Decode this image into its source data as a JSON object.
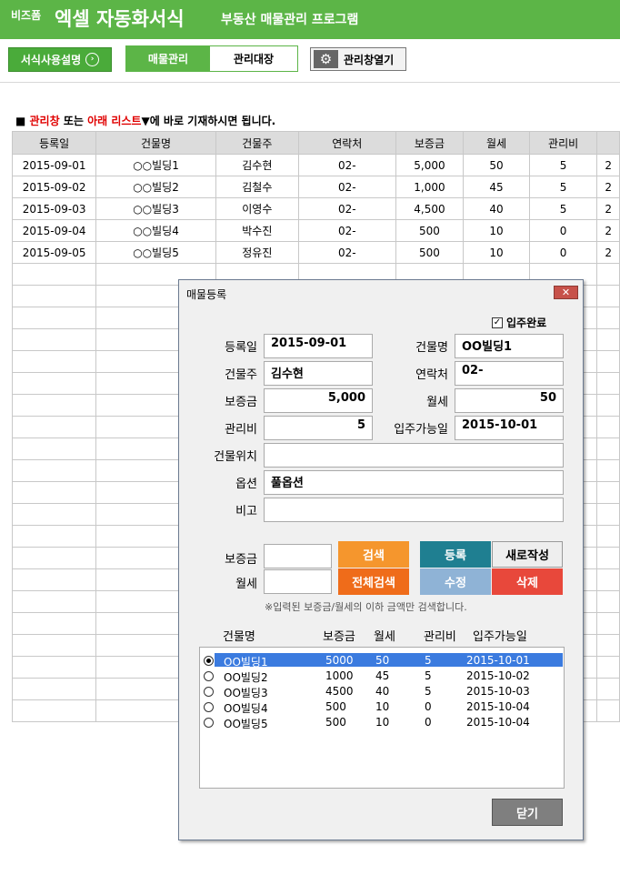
{
  "header": {
    "brand_small": "비즈폼",
    "brand_big": "엑셀 자동화서식",
    "subtitle": "부동산 매물관리 프로그램"
  },
  "toolbar": {
    "guide_label": "서식사용설명",
    "tabs": [
      "매물관리",
      "관리대장"
    ],
    "open_label": "관리창열기"
  },
  "note": {
    "prefix": "■ ",
    "red1": "관리창",
    "mid": " 또는 ",
    "red2": "아래 리스트",
    "suffix": "▼에 바로 기재하시면 됩니다."
  },
  "sheet": {
    "headers": [
      "등록일",
      "건물명",
      "건물주",
      "연락처",
      "보증금",
      "월세",
      "관리비",
      ""
    ],
    "rows": [
      [
        "2015-09-01",
        "○○빌딩1",
        "김수현",
        "02-",
        "5,000",
        "50",
        "5",
        "2"
      ],
      [
        "2015-09-02",
        "○○빌딩2",
        "김철수",
        "02-",
        "1,000",
        "45",
        "5",
        "2"
      ],
      [
        "2015-09-03",
        "○○빌딩3",
        "이영수",
        "02-",
        "4,500",
        "40",
        "5",
        "2"
      ],
      [
        "2015-09-04",
        "○○빌딩4",
        "박수진",
        "02-",
        "500",
        "10",
        "0",
        "2"
      ],
      [
        "2015-09-05",
        "○○빌딩5",
        "정유진",
        "02-",
        "500",
        "10",
        "0",
        "2"
      ]
    ]
  },
  "dialog": {
    "title": "매물등록",
    "close_x": "✕",
    "move_in_done": "입주완료",
    "check_mark": "✓",
    "labels": {
      "reg_date": "등록일",
      "building": "건물명",
      "owner": "건물주",
      "contact": "연락처",
      "deposit": "보증금",
      "rent": "월세",
      "fee": "관리비",
      "move_in": "입주가능일",
      "location": "건물위치",
      "option": "옵션",
      "memo": "비고",
      "s_deposit": "보증금",
      "s_rent": "월세"
    },
    "values": {
      "reg_date": "2015-09-01",
      "building": "OO빌딩1",
      "owner": "김수현",
      "contact": "02-",
      "deposit": "5,000",
      "rent": "50",
      "fee": "5",
      "move_in": "2015-10-01",
      "location": "",
      "option": "풀옵션",
      "memo": "",
      "s_deposit": "",
      "s_rent": ""
    },
    "buttons": {
      "search": "검색",
      "search_all": "전체검색",
      "register": "등록",
      "new": "새로작성",
      "edit": "수정",
      "delete": "삭제",
      "close": "닫기"
    },
    "hint": "※입력된 보증금/월세의 이하 금액만 검색합니다.",
    "list_headers": [
      "건물명",
      "보증금",
      "월세",
      "관리비",
      "입주가능일"
    ],
    "list_rows": [
      [
        "OO빌딩1",
        "5000",
        "50",
        "5",
        "2015-10-01"
      ],
      [
        "OO빌딩2",
        "1000",
        "45",
        "5",
        "2015-10-02"
      ],
      [
        "OO빌딩3",
        "4500",
        "40",
        "5",
        "2015-10-03"
      ],
      [
        "OO빌딩4",
        "500",
        "10",
        "0",
        "2015-10-04"
      ],
      [
        "OO빌딩5",
        "500",
        "10",
        "0",
        "2015-10-04"
      ]
    ],
    "selected_index": 0
  },
  "colors": {
    "brand_green": "#5cb547",
    "orange": "#f5962d",
    "dark_orange": "#ef6c1a",
    "teal": "#1f7f91",
    "light_blue": "#8fb3d6",
    "red": "#e8483b",
    "selection": "#3b7bdf"
  }
}
